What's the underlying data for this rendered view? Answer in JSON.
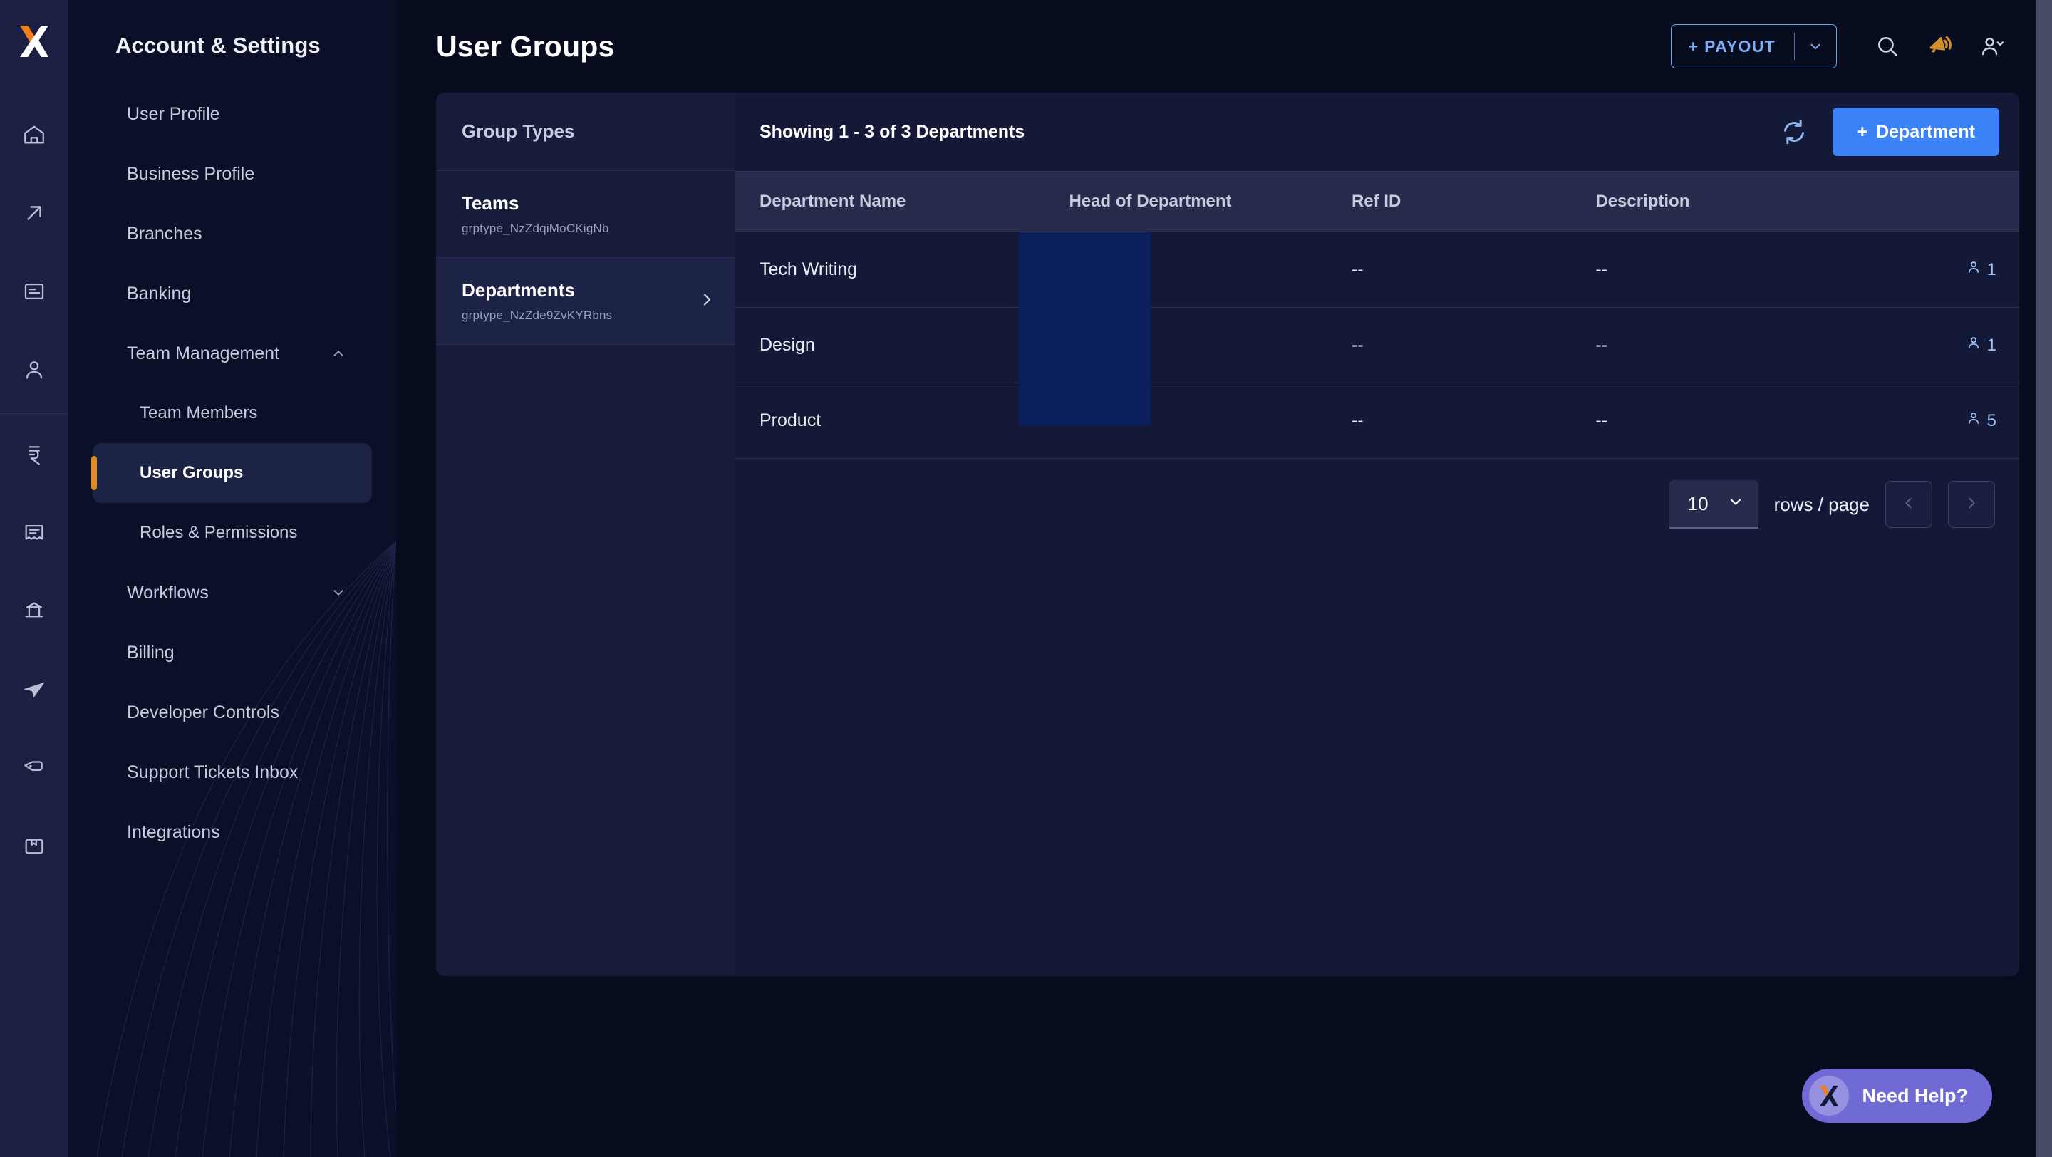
{
  "app": {
    "logo_icon": "x-logo",
    "accent_orange": "#e08b29",
    "accent_blue": "#3b82f6",
    "overlay_block_color": "#0b1f5c"
  },
  "rail": {
    "items": [
      {
        "icon": "home-icon",
        "name": "home"
      },
      {
        "icon": "arrow-up-right-icon",
        "name": "payments-out"
      },
      {
        "icon": "document-icon",
        "name": "documents"
      },
      {
        "icon": "person-icon",
        "name": "contacts"
      },
      {
        "icon": "rupee-icon",
        "name": "payments"
      },
      {
        "icon": "receipt-icon",
        "name": "invoices"
      },
      {
        "icon": "bank-icon",
        "name": "banking"
      },
      {
        "icon": "send-icon",
        "name": "send"
      },
      {
        "icon": "tag-icon",
        "name": "tags"
      },
      {
        "icon": "book-icon",
        "name": "ledger"
      }
    ]
  },
  "sidebar": {
    "title": "Account & Settings",
    "items": [
      {
        "label": "User Profile",
        "type": "item",
        "active": false
      },
      {
        "label": "Business Profile",
        "type": "item",
        "active": false
      },
      {
        "label": "Branches",
        "type": "item",
        "active": false
      },
      {
        "label": "Banking",
        "type": "item",
        "active": false
      },
      {
        "label": "Team Management",
        "type": "group",
        "expanded": true,
        "chevron": "chevron-up-icon"
      },
      {
        "label": "Team Members",
        "type": "sub",
        "active": false
      },
      {
        "label": "User Groups",
        "type": "sub",
        "active": true
      },
      {
        "label": "Roles & Permissions",
        "type": "sub",
        "active": false
      },
      {
        "label": "Workflows",
        "type": "group",
        "expanded": false,
        "chevron": "chevron-down-icon"
      },
      {
        "label": "Billing",
        "type": "item",
        "active": false
      },
      {
        "label": "Developer Controls",
        "type": "item",
        "active": false
      },
      {
        "label": "Support Tickets Inbox",
        "type": "item",
        "active": false
      },
      {
        "label": "Integrations",
        "type": "item",
        "active": false
      }
    ]
  },
  "header": {
    "page_title": "User Groups",
    "payout_label": "+ PAYOUT",
    "payout_caret_icon": "chevron-down-icon",
    "search_icon": "search-icon",
    "announcement_icon": "megaphone-icon",
    "account_icon": "user-chevron-icon"
  },
  "group_types_panel": {
    "heading": "Group Types",
    "items": [
      {
        "name": "Teams",
        "id": "grptype_NzZdqiMoCKigNb",
        "selected": false
      },
      {
        "name": "Departments",
        "id": "grptype_NzZde9ZvKYRbns",
        "selected": true,
        "arrow_icon": "chevron-right-icon"
      }
    ]
  },
  "table_panel": {
    "showing_text": "Showing 1 - 3 of 3 Departments",
    "refresh_icon": "refresh-icon",
    "add_button_label": "Department",
    "add_button_plus": "+",
    "columns": [
      "Department Name",
      "Head of Department",
      "Ref ID",
      "Description"
    ],
    "rows": [
      {
        "name": "Tech Writing",
        "head": "",
        "ref_id": "--",
        "description": "--",
        "members": "1"
      },
      {
        "name": "Design",
        "head": "",
        "ref_id": "--",
        "description": "--",
        "members": "1"
      },
      {
        "name": "Product",
        "head": "",
        "ref_id": "--",
        "description": "--",
        "members": "5"
      }
    ],
    "member_icon": "person-icon"
  },
  "pagination": {
    "rows_per_page_value": "10",
    "rows_per_page_label": "rows / page",
    "caret_icon": "chevron-down-icon",
    "prev_icon": "chevron-left-icon",
    "next_icon": "chevron-right-icon",
    "prev_disabled": true,
    "next_disabled": true
  },
  "help_widget": {
    "label": "Need Help?",
    "logo_icon": "x-logo"
  }
}
